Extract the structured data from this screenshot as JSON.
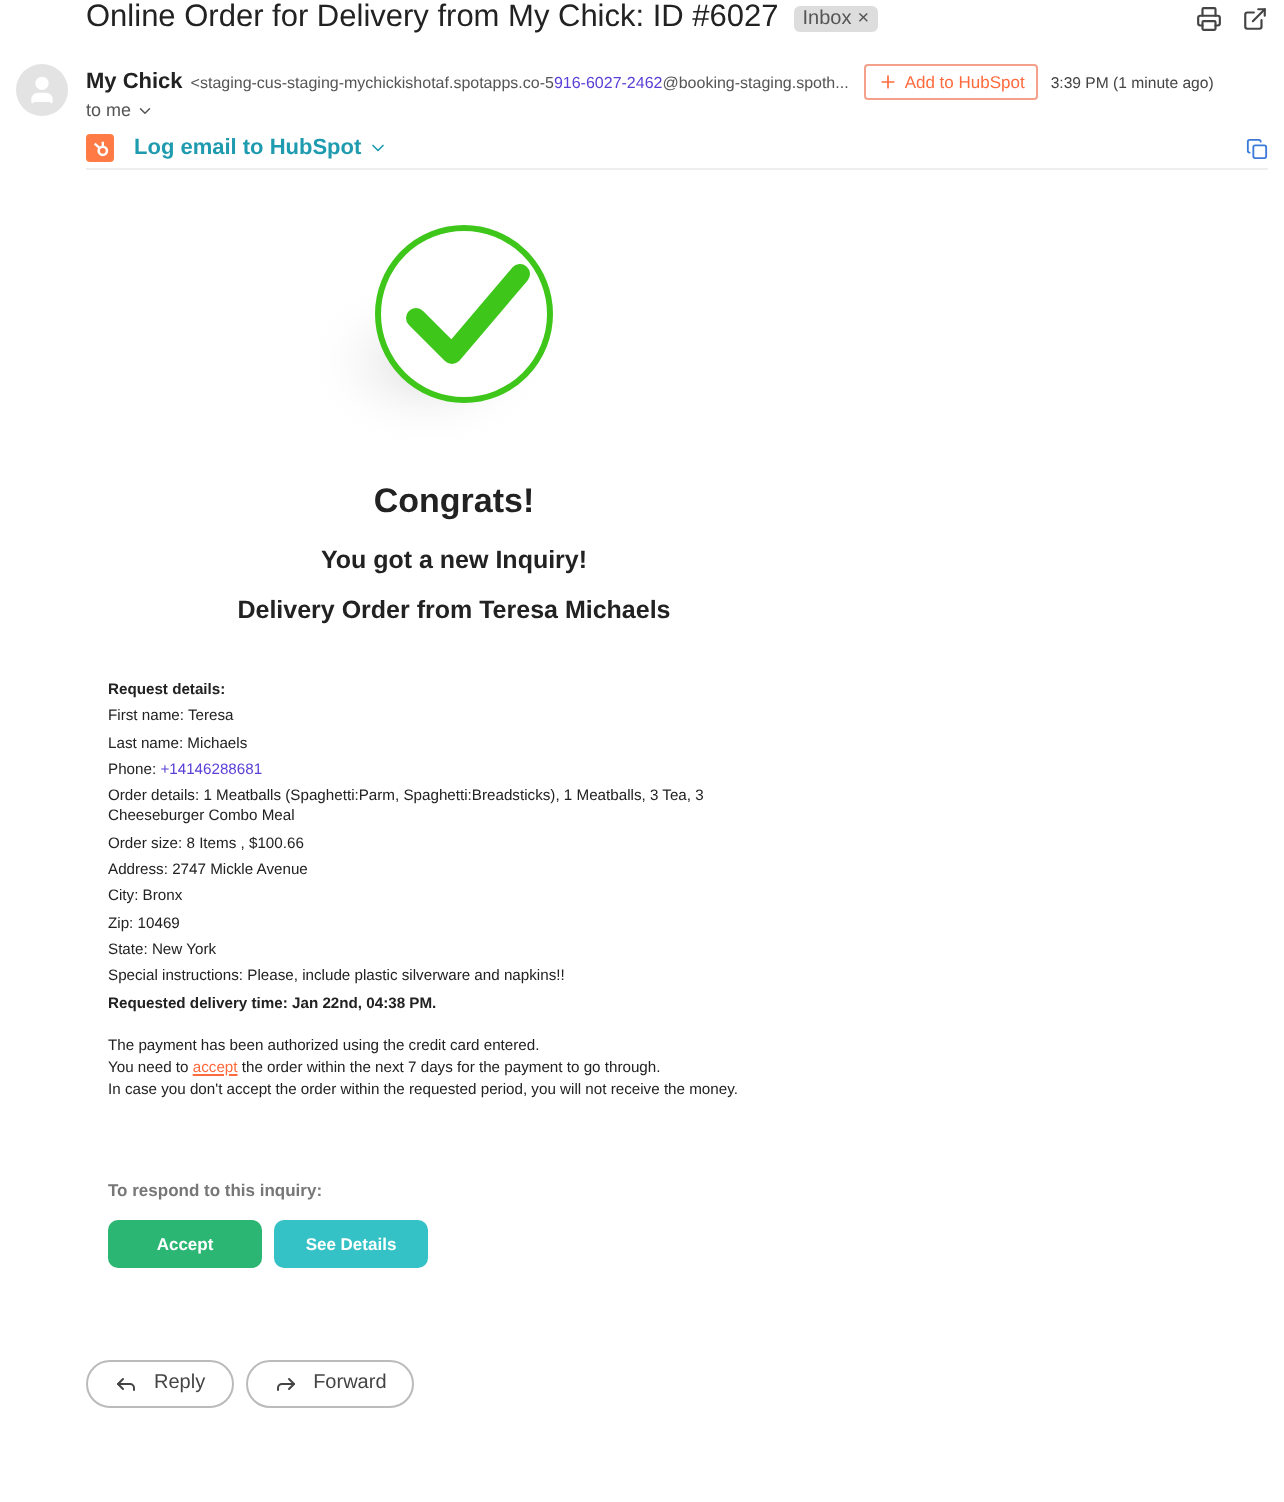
{
  "subject": {
    "title": "Online Order for Delivery from My Chick: ID #6027",
    "label": "Inbox",
    "label_close": "×"
  },
  "sender": {
    "name": "My Chick",
    "address_before": "<staging-cus-staging-mychickishotaf.spotapps.co-5",
    "address_link": "916-6027-2462",
    "address_after": "@booking-staging.spoth...",
    "recipient": "to me",
    "add_button": "Add to HubSpot",
    "time": "3:39 PM (1 minute ago)"
  },
  "hubspot": {
    "label": "Log email to HubSpot"
  },
  "email": {
    "congrats": "Congrats!",
    "subtitle": "You got a new Inquiry!",
    "heading": "Delivery Order from Teresa Michaels",
    "details": [
      {
        "before": "Request details:",
        "bold": true
      },
      {
        "before": "First name: Teresa",
        "bold": false
      },
      {
        "before": "Last name: Michaels",
        "bold": false
      },
      {
        "before": "Phone: ",
        "link": "+14146288681",
        "bold": false
      },
      {
        "before": "Order details: 1 Meatballs (Spaghetti:Parm, Spaghetti:Breadsticks), 1 Meatballs, 3 Tea, 3 Cheeseburger Combo Meal",
        "bold": false
      },
      {
        "before": "Order size: 8 Items , $100.66",
        "bold": false
      },
      {
        "before": "Address: 2747 Mickle Avenue",
        "bold": false
      },
      {
        "before": "City: Bronx",
        "bold": false
      },
      {
        "before": "Zip: 10469",
        "bold": false
      },
      {
        "before": "State: New York",
        "bold": false
      },
      {
        "before": "Special instructions: Please, include plastic silverware and napkins!!",
        "bold": false
      },
      {
        "before": "Requested delivery time: Jan 22nd, 04:38 PM.",
        "bold": true
      }
    ],
    "payment": [
      {
        "before": "The payment has been authorized using the credit card entered."
      },
      {
        "before": "You need to ",
        "link": "accept",
        "after": " the order within the next 7 days for the payment to go through."
      },
      {
        "before": "In case you don't accept the order within the requested period, you will not receive the money."
      }
    ],
    "respond": "To respond to this inquiry:",
    "actions": [
      {
        "label": "Accept",
        "kind": "primary"
      },
      {
        "label": "See Details",
        "kind": "secondary"
      }
    ]
  },
  "footer_buttons": [
    {
      "label": "Reply",
      "kind": "reply"
    },
    {
      "label": "Forward",
      "kind": "forward"
    }
  ]
}
